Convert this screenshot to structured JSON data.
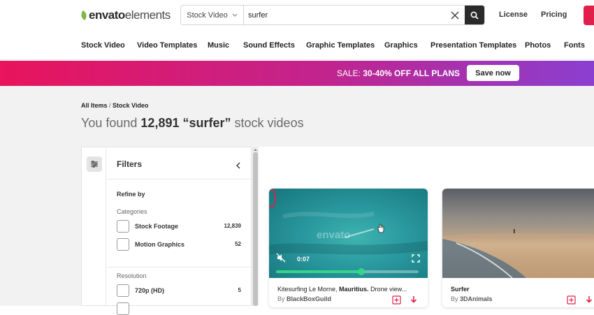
{
  "header": {
    "logo_bold": "envato",
    "logo_rest": "elements",
    "search": {
      "category": "Stock Video",
      "value": "surfer"
    },
    "links": [
      "License",
      "Pricing"
    ]
  },
  "nav": [
    "Stock Video",
    "Video Templates",
    "Music",
    "Sound Effects",
    "Graphic Templates",
    "Graphics",
    "Presentation Templates",
    "Photos",
    "Fonts"
  ],
  "promo": {
    "prefix": "SALE: ",
    "offer": "30-40% OFF ALL PLANS",
    "button": "Save now"
  },
  "hero": {
    "breadcrumb": [
      "All Items",
      "Stock Video"
    ],
    "breadcrumb_sep": " / ",
    "found_prefix": "You found ",
    "count": "12,891",
    "query": "“surfer”",
    "found_suffix": " stock videos"
  },
  "filters": {
    "title": "Filters",
    "refine": "Refine by",
    "categories_label": "Categories",
    "categories": [
      {
        "name": "Stock Footage",
        "count": "12,839"
      },
      {
        "name": "Motion Graphics",
        "count": "52"
      }
    ],
    "resolution_label": "Resolution",
    "resolutions": [
      {
        "name": "720p (HD)",
        "count": "5"
      }
    ]
  },
  "cards": [
    {
      "watermark": "envato",
      "timecode": "0:07",
      "progress": 0.6,
      "title_plain": "Kitesurfing Le Morne, ",
      "title_bold": "Mauritius.",
      "title_rest": " Drone view...",
      "by": "By ",
      "author": "BlackBoxGuild"
    },
    {
      "title_plain": "Surfer",
      "title_bold": "",
      "title_rest": "",
      "by": "By ",
      "author": "3DAnimals"
    }
  ],
  "colors": {
    "accent": "#e0204a",
    "progress": "#34d58a",
    "logo_leaf": "#82b541"
  }
}
